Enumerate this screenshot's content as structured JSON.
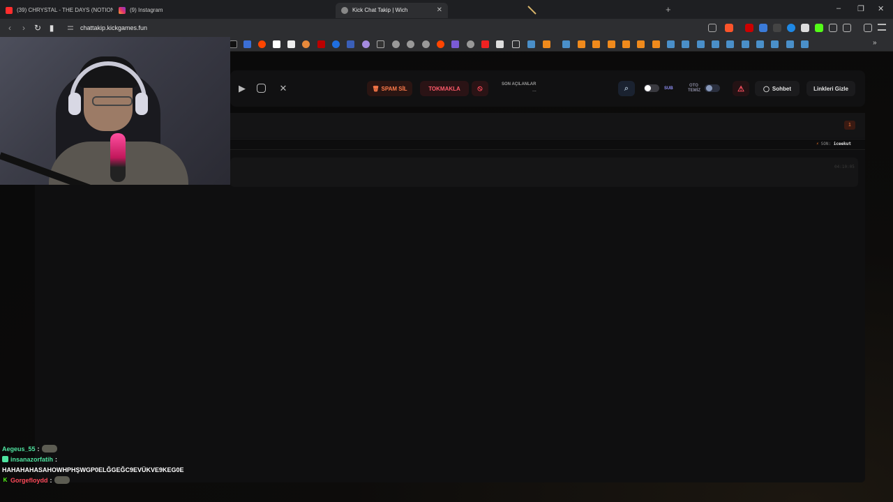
{
  "browser": {
    "tabs": [
      {
        "title": "(39) CHRYSTAL - THE DAYS (NOTION",
        "favicon": "youtube-icon",
        "color": "#ff2d2d"
      },
      {
        "title": "(9) Instagram",
        "favicon": "instagram-icon",
        "color": "#e1306c"
      },
      {
        "title": "Kick Chat Takip | Wich",
        "favicon": "globe-icon",
        "active": true
      }
    ],
    "new_tab": "+",
    "url": "chattakip.kickgames.fun"
  },
  "toolbar": {
    "spam_button": "SPAM SİL",
    "spam_icon": "🗑",
    "tokmak_button": "TOKMAKLA",
    "ban_icon": "⦸",
    "recent_label": "SON AÇILANLAR",
    "recent_value": "...",
    "sub_label": "SUB",
    "oto_label_1": "OTO",
    "oto_label_2": "TEMİZ",
    "chat_button": "Sohbet",
    "links_button": "Linkleri Gizle"
  },
  "panel": {
    "badge": "1",
    "last_label": "SON:",
    "last_user": "iceekut",
    "message_time": "04:10:05"
  },
  "stream_chat": [
    {
      "user": "Aegeus_55",
      "color": "#4fe3a0",
      "message": "",
      "emote": true
    },
    {
      "user": "insanazorfatih",
      "color": "#4fe3a0",
      "message": "HAHAHAHASAHOWHPHŞWGP0ELĞGEĞC9EVÜKVE9KEG0E",
      "badge": true
    },
    {
      "user": "Gorgefloydd",
      "color": "#ff4a5a",
      "message": "",
      "emote": true,
      "kick_badge": "K"
    }
  ],
  "colors": {
    "accent_orange": "#ff7b4a",
    "accent_red": "#ff5a6a",
    "chrome_bg": "#2d2e31"
  }
}
